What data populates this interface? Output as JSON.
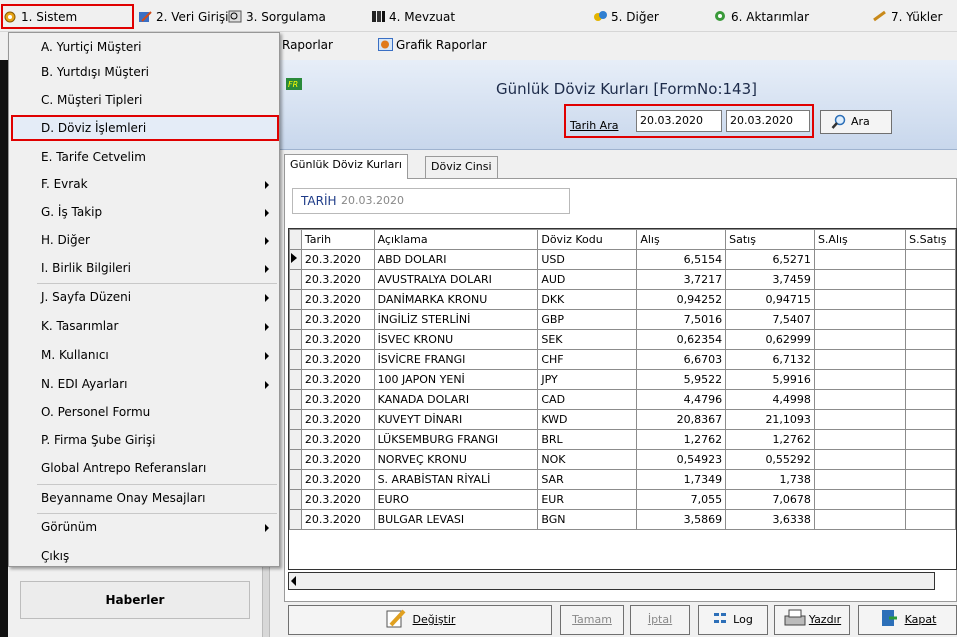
{
  "menubar": {
    "items": [
      "1. Sistem",
      "2. Veri Girişi",
      "3. Sorgulama",
      "4. Mevzuat",
      "5. Diğer",
      "6. Aktarımlar",
      "7. Yükler"
    ]
  },
  "subbar": {
    "items": [
      "Raporlar",
      "Grafik Raporlar"
    ]
  },
  "dropdown": {
    "items": [
      {
        "label": "A. Yurtiçi Müşteri",
        "submenu": false
      },
      {
        "label": "B. Yurtdışı Müşteri",
        "submenu": false
      },
      {
        "label": "C. Müşteri Tipleri",
        "submenu": false
      },
      {
        "label": "D. Döviz İşlemleri",
        "submenu": false,
        "highlighted": true
      },
      {
        "label": "E. Tarife Cetvelim",
        "submenu": false
      },
      {
        "label": "F. Evrak",
        "submenu": true
      },
      {
        "label": "G. İş Takip",
        "submenu": true
      },
      {
        "label": "H. Diğer",
        "submenu": true
      },
      {
        "label": "I. Birlik Bilgileri",
        "submenu": true
      },
      {
        "label": "J. Sayfa Düzeni",
        "submenu": true
      },
      {
        "label": "K. Tasarımlar",
        "submenu": true
      },
      {
        "label": "M. Kullanıcı",
        "submenu": true
      },
      {
        "label": "N. EDI Ayarları",
        "submenu": true
      },
      {
        "label": "O. Personel Formu",
        "submenu": false
      },
      {
        "label": "P. Firma Şube Girişi",
        "submenu": false
      },
      {
        "label": "Global Antrepo Referansları",
        "submenu": false
      },
      {
        "label": "Beyanname Onay Mesajları",
        "submenu": false
      },
      {
        "label": "Görünüm",
        "submenu": true
      },
      {
        "label": "Çıkış",
        "submenu": false
      }
    ]
  },
  "left_panel": {
    "haberler": "Haberler"
  },
  "form": {
    "title": "Günlük Döviz Kurları [FormNo:143]",
    "search": {
      "label": "Tarih Ara",
      "date_from": "20.03.2020",
      "date_to": "20.03.2020",
      "button": "Ara"
    },
    "tabs": [
      "Günlük Döviz Kurları",
      "Döviz Cinsi"
    ],
    "tarih_label": "TARİH",
    "tarih_value": "20.03.2020",
    "grid": {
      "columns": [
        "Tarih",
        "Açıklama",
        "Döviz Kodu",
        "Alış",
        "Satış",
        "S.Alış",
        "S.Satış"
      ],
      "rows": [
        [
          "20.3.2020",
          "ABD DOLARI",
          "USD",
          "6,5154",
          "6,5271"
        ],
        [
          "20.3.2020",
          "AVUSTRALYA DOLARI",
          "AUD",
          "3,7217",
          "3,7459"
        ],
        [
          "20.3.2020",
          "DANİMARKA KRONU",
          "DKK",
          "0,94252",
          "0,94715"
        ],
        [
          "20.3.2020",
          "İNGİLİZ STERLİNİ",
          "GBP",
          "7,5016",
          "7,5407"
        ],
        [
          "20.3.2020",
          "İSVEC KRONU",
          "SEK",
          "0,62354",
          "0,62999"
        ],
        [
          "20.3.2020",
          "İSVİCRE FRANGI",
          "CHF",
          "6,6703",
          "6,7132"
        ],
        [
          "20.3.2020",
          "100 JAPON YENİ",
          "JPY",
          "5,9522",
          "5,9916"
        ],
        [
          "20.3.2020",
          "KANADA DOLARI",
          "CAD",
          "4,4796",
          "4,4998"
        ],
        [
          "20.3.2020",
          "KUVEYT DİNARI",
          "KWD",
          "20,8367",
          "21,1093"
        ],
        [
          "20.3.2020",
          "LÜKSEMBURG FRANGI",
          "BRL",
          "1,2762",
          "1,2762"
        ],
        [
          "20.3.2020",
          "NORVEÇ KRONU",
          "NOK",
          "0,54923",
          "0,55292"
        ],
        [
          "20.3.2020",
          "S. ARABİSTAN RİYALİ",
          "SAR",
          "1,7349",
          "1,738"
        ],
        [
          "20.3.2020",
          "EURO",
          "EUR",
          "7,055",
          "7,0678"
        ],
        [
          "20.3.2020",
          "BULGAR LEVASI",
          "BGN",
          "3,5869",
          "3,6338"
        ]
      ]
    },
    "buttons": {
      "degistir": "Değiştir",
      "tamam": "Tamam",
      "iptal": "İptal",
      "log": "Log",
      "yazdir": "Yazdır",
      "kapat": "Kapat"
    }
  },
  "colors": {
    "highlight_red": "#e00000",
    "title_text": "#1d2b4a",
    "tarih_label": "#1f3c88"
  }
}
